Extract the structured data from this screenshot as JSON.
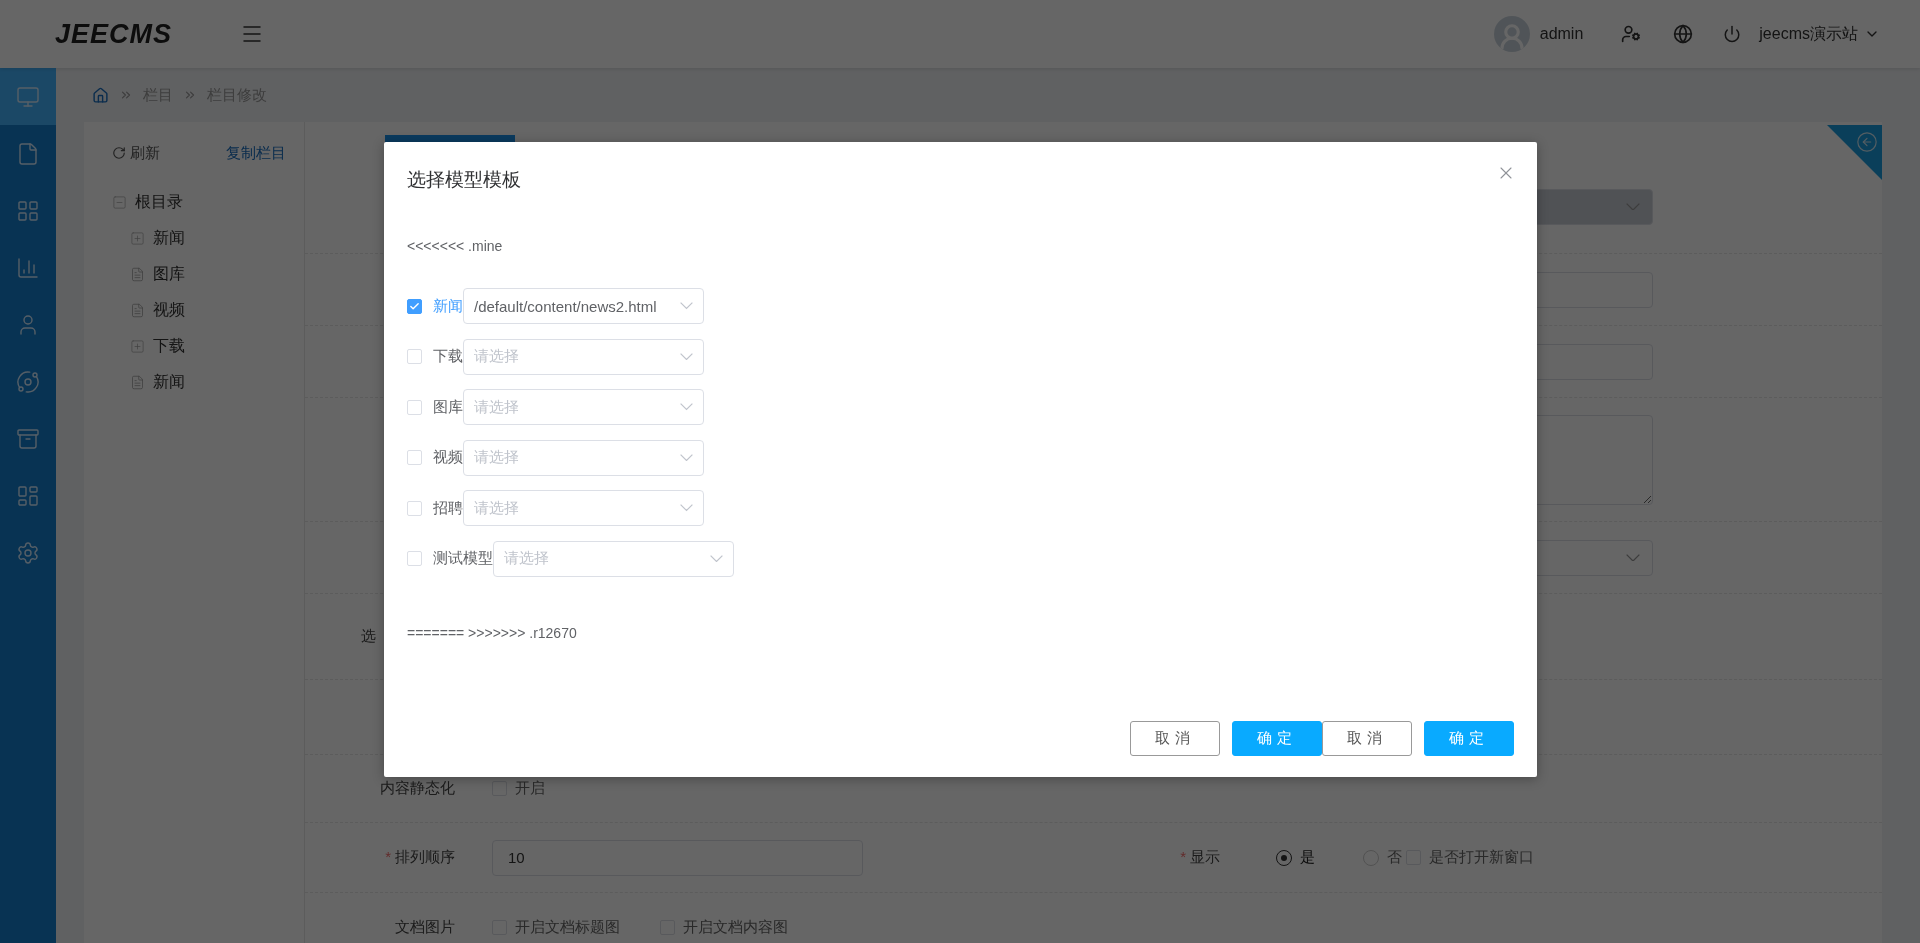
{
  "header": {
    "logo": "JEECMS",
    "user": "admin",
    "site": "jeecms演示站"
  },
  "sidebar": {
    "items": [
      {
        "selected": true
      },
      {
        "selected": false
      },
      {
        "selected": false
      },
      {
        "selected": false
      },
      {
        "selected": false
      },
      {
        "selected": false
      },
      {
        "selected": false
      },
      {
        "selected": false
      },
      {
        "selected": false
      }
    ]
  },
  "breadcrumb": [
    "栏目",
    "栏目修改"
  ],
  "tree_panel": {
    "refresh": "刷新",
    "copy": "复制栏目",
    "tree": [
      {
        "label": "根目录",
        "kind": "folder",
        "expanded": true,
        "children": [
          {
            "label": "新闻",
            "kind": "folder",
            "expanded": false
          },
          {
            "label": "图库",
            "kind": "leaf"
          },
          {
            "label": "视频",
            "kind": "leaf"
          },
          {
            "label": "下载",
            "kind": "folder",
            "expanded": false
          },
          {
            "label": "新闻",
            "kind": "leaf"
          }
        ]
      }
    ]
  },
  "form": {
    "tabs": [
      {
        "selected": true
      }
    ],
    "hidden_rows": [
      {
        "kind": "select",
        "disabled": true
      },
      {
        "kind": "input",
        "disabled": false
      },
      {
        "kind": "input",
        "disabled": false
      },
      {
        "kind": "textarea",
        "disabled": false
      },
      {
        "kind": "select",
        "disabled": false
      }
    ],
    "cut_label": "选",
    "static": {
      "label": "内容静态化",
      "option": {
        "label": "开启",
        "checked": false
      }
    },
    "order": {
      "label": "排列顺序",
      "required_mark": "*",
      "value": "10"
    },
    "display": {
      "label": "显示",
      "required_mark": "*",
      "options": [
        {
          "label": "是",
          "selected": true
        },
        {
          "label": "否",
          "selected": false
        }
      ],
      "new_window": {
        "label": "是否打开新窗口",
        "checked": false
      }
    },
    "doc_images": {
      "label": "文档图片",
      "options": [
        {
          "label": "开启文档标题图",
          "checked": false
        },
        {
          "label": "开启文档内容图",
          "checked": false
        }
      ]
    }
  },
  "dialog": {
    "title": "选择模型模板",
    "text_before": "<<<<<<< .mine",
    "rows": [
      {
        "label": "新闻",
        "checked": true,
        "value": "/default/content/news2.html"
      },
      {
        "label": "下载",
        "checked": false,
        "placeholder": "请选择"
      },
      {
        "label": "图库",
        "checked": false,
        "placeholder": "请选择"
      },
      {
        "label": "视频",
        "checked": false,
        "placeholder": "请选择"
      },
      {
        "label": "招聘",
        "checked": false,
        "placeholder": "请选择"
      },
      {
        "label": "测试模型",
        "checked": false,
        "placeholder": "请选择"
      }
    ],
    "text_after": "======= >>>>>>> .r12670",
    "buttons": [
      {
        "label": "取消",
        "kind": "default"
      },
      {
        "label": "确定",
        "kind": "primary"
      },
      {
        "label": "取消",
        "kind": "default"
      },
      {
        "label": "确定",
        "kind": "primary"
      }
    ]
  }
}
